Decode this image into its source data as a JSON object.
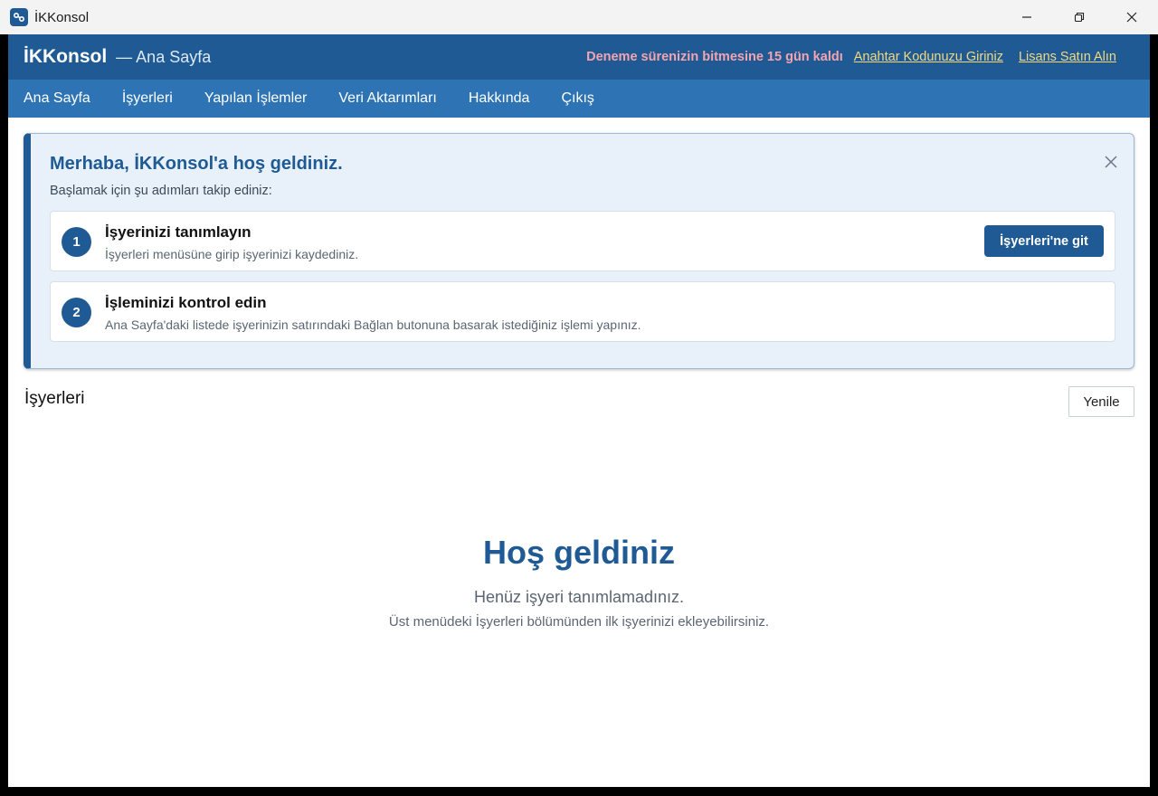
{
  "titlebar": {
    "title": "İKKonsol",
    "icon": "app-logo-icon",
    "controls": [
      "minimize-icon",
      "restore-icon",
      "close-icon"
    ]
  },
  "header": {
    "brand": "İKKonsol",
    "page": "— Ana Sayfa",
    "trial_notice": "Deneme sürenizin bitmesine 15 gün kaldı",
    "key_link": "Anahtar Kodunuzu Giriniz",
    "buy_link": "Lisans Satın Alın"
  },
  "nav": {
    "items": [
      {
        "label": "Ana Sayfa"
      },
      {
        "label": "İşyerleri"
      },
      {
        "label": "Yapılan İşlemler"
      },
      {
        "label": "Veri Aktarımları"
      },
      {
        "label": "Hakkında"
      },
      {
        "label": "Çıkış"
      }
    ]
  },
  "welcome": {
    "title": "Merhaba, İKKonsol'a hoş geldiniz.",
    "subtitle": "Başlamak için şu adımları takip ediniz:",
    "steps": [
      {
        "number": "1",
        "title": "İşyerinizi tanımlayın",
        "description": "İşyerleri menüsüne girip işyerinizi kaydediniz.",
        "button": "İşyerleri'ne git"
      },
      {
        "number": "2",
        "title": "İşleminizi kontrol edin",
        "description": "Ana Sayfa'daki listede işyerinizin satırındaki Bağlan butonuna basarak istediğiniz işlemi yapınız."
      }
    ]
  },
  "workplaces": {
    "title": "İşyerleri",
    "refresh_label": "Yenile"
  },
  "empty_state": {
    "title": "Hoş geldiniz",
    "line1": "Henüz işyeri tanımlamadınız.",
    "line2": "Üst menüdeki İşyerleri bölümünden ilk işyerinizi ekleyebilirsiniz."
  },
  "colors": {
    "primary": "#1f5a94",
    "nav": "#2e74b5",
    "trial": "#f5a3ae",
    "link": "#f4d97a",
    "card_bg": "#e8f1fa"
  }
}
